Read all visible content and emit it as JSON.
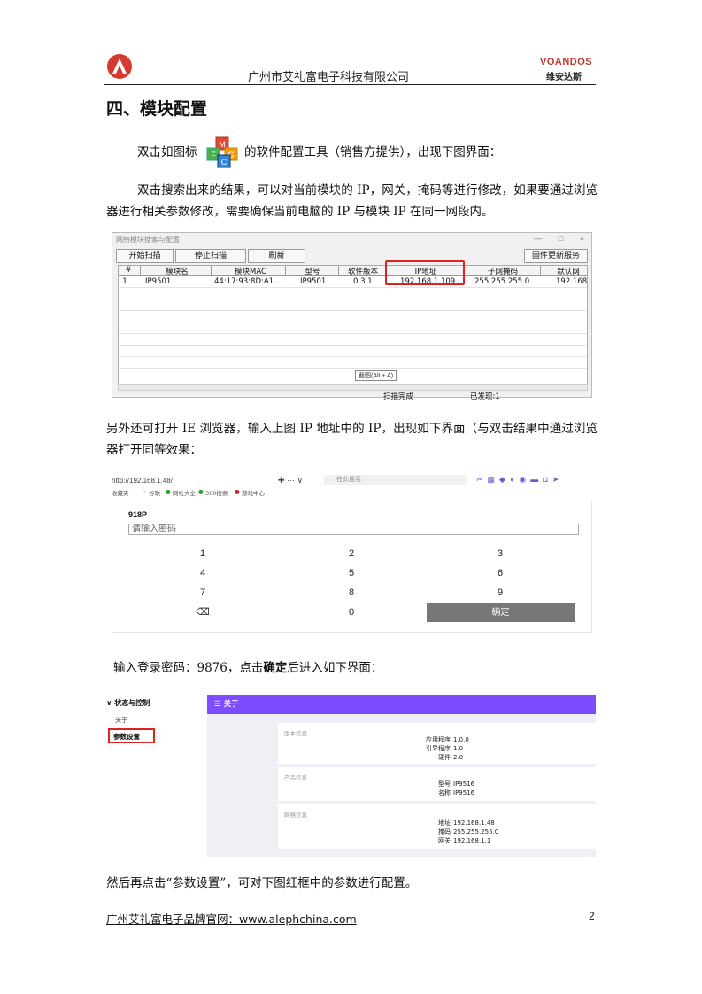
{
  "header": {
    "company": "广州市艾礼富电子科技有限公司",
    "brand": "VOANDOS",
    "brand_cn": "维安达斯"
  },
  "section_title": "四、模块配置",
  "paragraphs": {
    "p1_a": "双击如图标",
    "p1_b": "的软件配置工具（销售方提供），出现下图界面：",
    "p2": "双击搜索出来的结果，可以对当前模块的 IP，网关，掩码等进行修改，如果要通过浏览器进行相关参数修改，需要确保当前电脑的 IP 与模块 IP 在同一网段内。",
    "p3": "另外还可打开 IE 浏览器，输入上图 IP 地址中的 IP，出现如下界面（与双击结果中通过浏览器打开同等效果：",
    "p4_a": "输入登录密码：9876，点击",
    "p4_bold": "确定",
    "p4_b": "后进入如下界面：",
    "p5": "然后再点击“参数设置”，可对下图红框中的参数进行配置。"
  },
  "tool_window": {
    "title": "网络模块搜索与配置",
    "controls": "— □ ×",
    "buttons": {
      "start_scan": "开始扫描",
      "stop_scan": "停止扫描",
      "refresh": "刷新",
      "firmware": "固件更新服务"
    },
    "columns": [
      "#",
      "模块名",
      "模块MAC",
      "型号",
      "软件版本",
      "IP地址",
      "子网掩码",
      "默认网"
    ],
    "rows": [
      [
        "1",
        "IP9501",
        "44:17:93:8D:A1...",
        "IP9501",
        "0.3.1",
        "192.168.1.109",
        "255.255.255.0",
        "192.168"
      ]
    ],
    "tooltip": "截图(Alt + A)",
    "status_scan": "扫描完成",
    "status_found": "已发现:1"
  },
  "browser": {
    "url": "http://192.168.1.48/",
    "search_placeholder": "在此搜索",
    "favorites": [
      "收藏夹",
      "谷歌",
      "网址大全",
      "360搜索",
      "游戏中心"
    ]
  },
  "keypad": {
    "title": "918P",
    "placeholder": "请输入密码",
    "keys": [
      "1",
      "2",
      "3",
      "4",
      "5",
      "6",
      "7",
      "8",
      "9",
      "⌫",
      "0"
    ],
    "confirm": "确定"
  },
  "admin": {
    "menu_group": "状态与控制",
    "menu_about": "关于",
    "menu_params": "参数设置",
    "topbar_title": "关于",
    "version_card": {
      "title": "版本信息",
      "items": [
        [
          "应用程序",
          "1.0.0"
        ],
        [
          "引导程序",
          "1.0"
        ],
        [
          "硬件",
          "2.0"
        ]
      ]
    },
    "product_card": {
      "title": "产品信息",
      "items": [
        [
          "型号",
          "IP9516"
        ],
        [
          "名称",
          "IP9516"
        ]
      ]
    },
    "network_card": {
      "title": "网络信息",
      "items": [
        [
          "地址",
          "192.168.1.48"
        ],
        [
          "掩码",
          "255.255.255.0"
        ],
        [
          "网关",
          "192.168.1.1"
        ]
      ]
    }
  },
  "footer": {
    "site": "广州艾礼富电子品牌官网：www.alephchina.com",
    "page": "2"
  },
  "colors": {
    "accent_purple": "#7c4dff",
    "highlight_red": "#dd2222",
    "logo_red": "#c0392b"
  }
}
